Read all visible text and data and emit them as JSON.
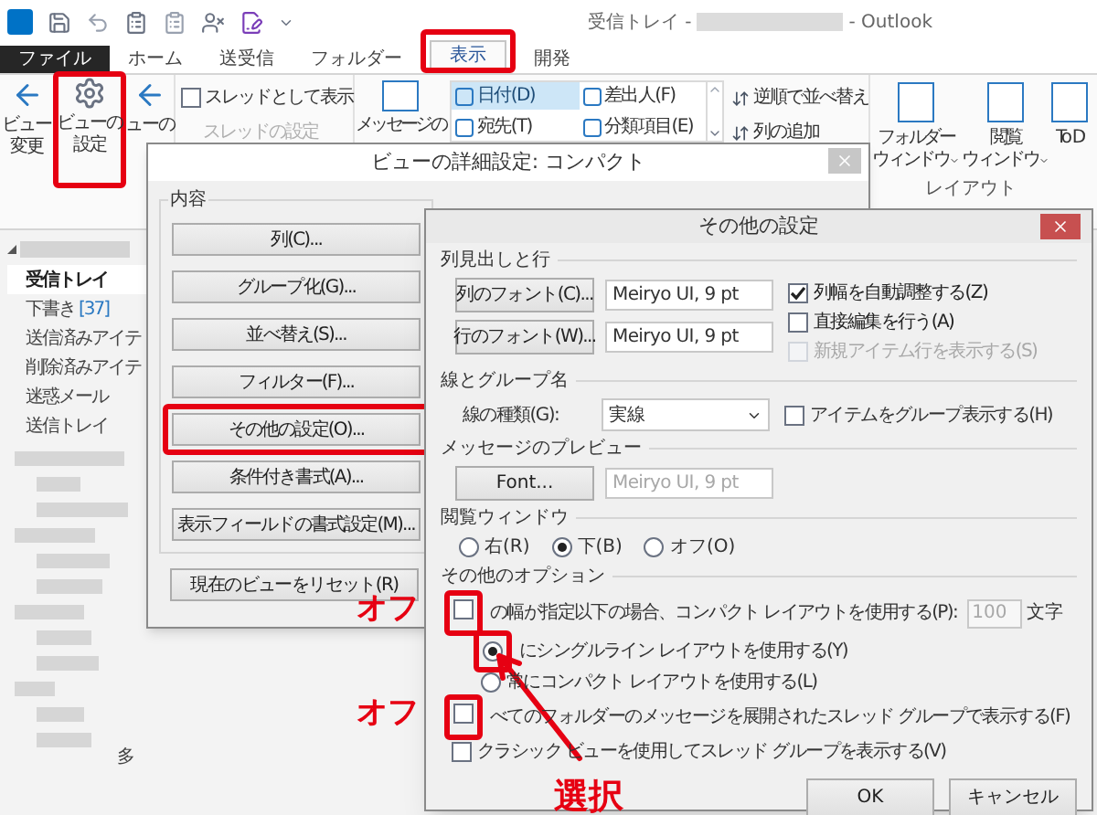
{
  "window": {
    "title_before": "受信トレイ -",
    "title_after": "- Outlook"
  },
  "tabs": [
    {
      "label": "ファイル",
      "kind": "file",
      "selected": false
    },
    {
      "label": "ホーム",
      "kind": "tab",
      "selected": false
    },
    {
      "label": "送受信",
      "kind": "tab",
      "selected": false
    },
    {
      "label": "フォルダー",
      "kind": "tab",
      "selected": false
    },
    {
      "label": "表示",
      "kind": "tab",
      "selected": true
    },
    {
      "label": "開発",
      "kind": "tab",
      "selected": false
    }
  ],
  "ribbon": {
    "view_buttons": [
      {
        "lines": [
          "ビュー",
          "変更"
        ],
        "highlighted": false
      },
      {
        "lines": [
          "ビューの",
          "設定"
        ],
        "highlighted": true
      },
      {
        "lines": [
          "ューの"
        ],
        "highlighted": false
      }
    ],
    "thread_checkbox": {
      "label": "スレッドとして表示",
      "checked": false
    },
    "thread_settings": {
      "label": "スレッドの設定",
      "disabled": true
    },
    "message_button": "メッセージの",
    "arrangement": [
      {
        "label": "日付(D)",
        "selected": true
      },
      {
        "label": "差出人(F)",
        "selected": false
      },
      {
        "label": "宛先(T)",
        "selected": false
      },
      {
        "label": "分類項目(E)",
        "selected": false
      }
    ],
    "sort_commands": [
      "逆順で並べ替え",
      "列の追加"
    ],
    "layout_buttons": [
      {
        "lines": [
          "フォルダー",
          "ウィンドウ"
        ],
        "dropdown": true
      },
      {
        "lines": [
          "閲覧",
          "ウィンドウ"
        ],
        "dropdown": true
      },
      {
        "lines": [
          "To D"
        ],
        "dropdown": false
      }
    ],
    "layout_group_label": "レイアウト"
  },
  "folder_pane": {
    "folders": [
      {
        "label": "受信トレイ",
        "selected": true
      },
      {
        "label": "下書き",
        "count": "[37]",
        "selected": false
      },
      {
        "label": "送信済みアイテ",
        "selected": false
      },
      {
        "label": "削除済みアイテ",
        "selected": false
      },
      {
        "label": "迷惑メール",
        "selected": false
      },
      {
        "label": "送信トレイ",
        "selected": false
      }
    ],
    "trailing_text": "多"
  },
  "view_dialog": {
    "title": "ビューの詳細設定: コンパクト",
    "group_label": "内容",
    "buttons": [
      {
        "label": "列(C)...",
        "highlighted": false
      },
      {
        "label": "グループ化(G)...",
        "highlighted": false
      },
      {
        "label": "並べ替え(S)...",
        "highlighted": false
      },
      {
        "label": "フィルター(F)...",
        "highlighted": false
      },
      {
        "label": "その他の設定(O)...",
        "highlighted": true
      },
      {
        "label": "条件付き書式(A)...",
        "highlighted": false
      },
      {
        "label": "表示フィールドの書式設定(M)...",
        "highlighted": false
      }
    ],
    "reset_button": "現在のビューをリセット(R)"
  },
  "options_dialog": {
    "title": "その他の設定",
    "columns_section": {
      "heading": "列見出しと行",
      "font_rows": [
        {
          "button": "列のフォント(C)...",
          "value": "Meiryo UI, 9 pt"
        },
        {
          "button": "行のフォント(W)...",
          "value": "Meiryo UI, 9 pt"
        }
      ],
      "checkboxes": [
        {
          "label": "列幅を自動調整する(Z)",
          "checked": true,
          "disabled": false
        },
        {
          "label": "直接編集を行う(A)",
          "checked": false,
          "disabled": false
        },
        {
          "label": "新規アイテム行を表示する(S)",
          "checked": false,
          "disabled": true
        }
      ]
    },
    "lines_section": {
      "heading": "線とグループ名",
      "line_style_label": "線の種類(G):",
      "line_style_value": "実線",
      "group_checkbox": {
        "label": "アイテムをグループ表示する(H)",
        "checked": false
      }
    },
    "preview_section": {
      "heading": "メッセージのプレビュー",
      "font_button": "Font...",
      "font_value": "Meiryo UI, 9 pt",
      "font_value_disabled": true
    },
    "reading_pane_section": {
      "heading": "閲覧ウィンドウ",
      "options": [
        {
          "label": "右(R)",
          "selected": false
        },
        {
          "label": "下(B)",
          "selected": true
        },
        {
          "label": "オフ(O)",
          "selected": false
        }
      ]
    },
    "other_section": {
      "heading": "その他のオプション",
      "compact_checkbox": {
        "label": "の幅が指定以下の場合、コンパクト レイアウトを使用する(P):",
        "checked": false,
        "annotated": true
      },
      "width_value": "100",
      "width_unit": "文字",
      "layout_options": [
        {
          "label": "にシングルライン レイアウトを使用する(Y)",
          "selected": true,
          "annotated": true
        },
        {
          "label": "常にコンパクト レイアウトを使用する(L)",
          "selected": false,
          "annotated": false
        }
      ],
      "checkboxes": [
        {
          "label": "べてのフォルダーのメッセージを展開されたスレッド グループで表示する(F)",
          "checked": false,
          "annotated": true
        },
        {
          "label": "クラシック ビューを使用してスレッド グループを表示する(V)",
          "checked": false,
          "annotated": false
        }
      ]
    },
    "buttons": [
      "OK",
      "キャンセル"
    ]
  },
  "annotations": {
    "off_labels": [
      "オフ",
      "オフ"
    ],
    "select_label": "選択"
  }
}
